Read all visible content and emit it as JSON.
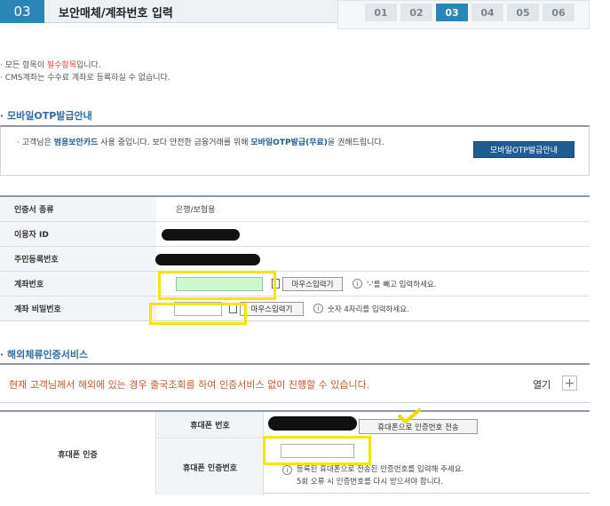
{
  "header": {
    "step_number": "03",
    "title": "보안매체/계좌번호 입력",
    "steps": [
      "01",
      "02",
      "03",
      "04",
      "05",
      "06"
    ],
    "active_step": "03"
  },
  "notices": {
    "line1_prefix": "모든 항목이 ",
    "line1_req": "필수항목",
    "line1_suffix": "입니다.",
    "line2": "CMS계좌는 수수료 계좌로 등록하실 수 없습니다."
  },
  "otp_section": {
    "title": "모바일OTP발급안내",
    "text_prefix": "고객님은 ",
    "text_bold1": "범용보안카드",
    "text_middle": " 사용 중입니다. 보다 안전한 금융거래를 위해 ",
    "text_bold2": "모바일OTP발급(무료)",
    "text_suffix": "을 권해드립니다.",
    "button_label": "모바일OTP발급안내"
  },
  "form": {
    "cert_type_label": "인증서 종류",
    "cert_type_value": "은행/보험용",
    "user_id_label": "이용자 ID",
    "resident_no_label": "주민등록번호",
    "account_no_label": "계좌번호",
    "account_mouse_btn": "마우스입력기",
    "account_hint": "'-'를 빼고 입력하세요.",
    "password_label": "계좌 비밀번호",
    "password_mouse_btn": "마우스입력기",
    "password_hint": "숫자 4자리를 입력하세요."
  },
  "overseas_section": {
    "title": "해외체류인증서비스",
    "text": "현재 고객님께서 해외에 있는 경우 출국조회를 하여 인증서비스 없이 진행할 수 있습니다.",
    "open_label": "열기",
    "plus_label": "+"
  },
  "phone_auth": {
    "main_label": "휴대폰 인증",
    "phone_no_label": "휴대폰 번호",
    "send_btn": "휴대폰으로 인증번호 전송",
    "code_label": "휴대폰 인증번호",
    "code_hint_line1": "등록된 휴대폰으로 전송된 인증번호를 입력해 주세요.",
    "code_hint_line2": "5회 오류 시 인증번호를 다시 받으셔야 합니다."
  },
  "colors": {
    "accent": "#2a85b8",
    "highlight": "#f7e400",
    "required": "#e0463a",
    "warning_text": "#c0592b"
  }
}
